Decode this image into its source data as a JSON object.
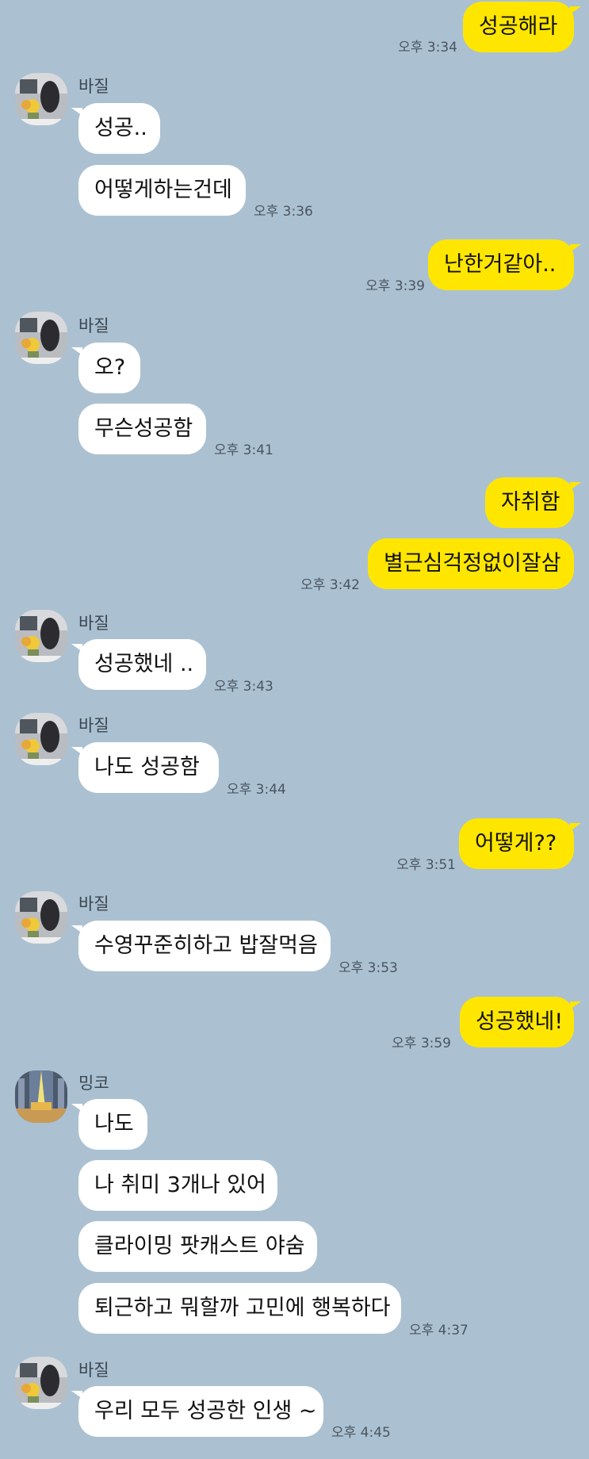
{
  "chat": {
    "messages": [
      {
        "text": "성공해라",
        "time": "오후 3:34"
      },
      {
        "sender": "바질",
        "text": "성공.."
      },
      {
        "text": "어떻게하는건데",
        "time": "오후 3:36"
      },
      {
        "text": "난한거같아..",
        "time": "오후 3:39"
      },
      {
        "sender": "바질",
        "text": "오?"
      },
      {
        "text": "무슨성공함",
        "time": "오후 3:41"
      },
      {
        "text": "자취함"
      },
      {
        "text": "별근심걱정없이잘삼",
        "time": "오후 3:42"
      },
      {
        "sender": "바질",
        "text": "성공했네 ..",
        "time": "오후 3:43"
      },
      {
        "sender": "바질",
        "text": "나도 성공함",
        "time": "오후 3:44"
      },
      {
        "text": "어떻게??",
        "time": "오후 3:51"
      },
      {
        "sender": "바질",
        "text": "수영꾸준히하고 밥잘먹음",
        "time": "오후 3:53"
      },
      {
        "text": "성공했네!",
        "time": "오후 3:59"
      },
      {
        "sender": "밍코",
        "text": "나도"
      },
      {
        "text": "나 취미 3개나 있어"
      },
      {
        "text": "클라이밍 팟캐스트 야숨"
      },
      {
        "text": "퇴근하고 뭐할까 고민에 행복하다",
        "time": "오후 4:37"
      },
      {
        "sender": "바질",
        "text": "우리 모두 성공한 인생 ~",
        "time": "오후 4:45"
      }
    ]
  },
  "colors": {
    "background": "#abc1d1",
    "incoming": "#ffffff",
    "outgoing": "#ffe600"
  }
}
